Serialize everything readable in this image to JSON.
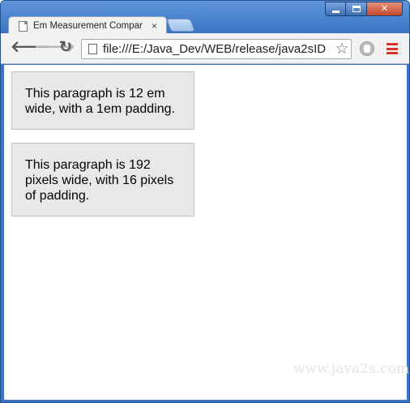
{
  "window": {
    "controls": {
      "minimize": "minimize-icon",
      "maximize": "maximize-icon",
      "close": "✕"
    }
  },
  "tab": {
    "title": "Em Measurement Compar",
    "close": "×"
  },
  "toolbar": {
    "back": "🡐",
    "forward": "🡒",
    "reload": "↻",
    "url": "file:///E:/Java_Dev/WEB/release/java2sID",
    "star": "☆",
    "menu_color": "#d8342b"
  },
  "content": {
    "paragraphs": [
      "This paragraph is 12 em wide, with a 1em padding.",
      "This paragraph is 192 pixels wide, with 16 pixels of padding."
    ],
    "watermark": "www.java2s.com"
  }
}
